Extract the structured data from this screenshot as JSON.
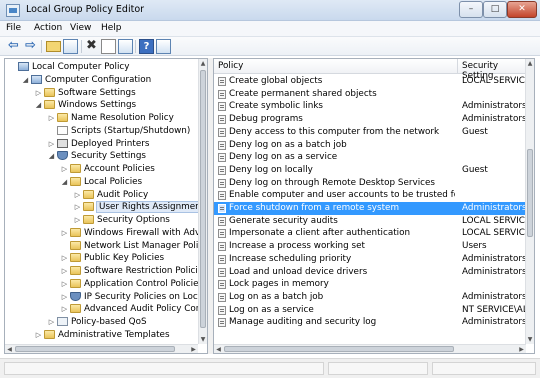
{
  "window": {
    "title": "Local Group Policy Editor",
    "minimize": "–",
    "maximize": "□",
    "close": "✕"
  },
  "menu": [
    "File",
    "Action",
    "View",
    "Help"
  ],
  "toolbar": {
    "back": "⇦",
    "forward": "⇨",
    "delete": "✖",
    "help": "?",
    "icons": [
      "back-arrow-icon",
      "forward-arrow-icon",
      "up-folder-icon",
      "show-hide-tree-icon",
      "delete-icon",
      "properties-icon",
      "export-list-icon",
      "help-icon",
      "show-hide-action-pane-icon"
    ]
  },
  "tree": {
    "scroll": {
      "up": "▲",
      "down": "▼",
      "left": "◀",
      "right": "▶"
    },
    "items": [
      {
        "label": "Local Computer Policy",
        "depth": 0,
        "expander": "",
        "icon": "computer"
      },
      {
        "label": "Computer Configuration",
        "depth": 1,
        "expander": "◢",
        "icon": "computer"
      },
      {
        "label": "Software Settings",
        "depth": 2,
        "expander": "▷",
        "icon": "folder"
      },
      {
        "label": "Windows Settings",
        "depth": 2,
        "expander": "◢",
        "icon": "folder"
      },
      {
        "label": "Name Resolution Policy",
        "depth": 3,
        "expander": "▷",
        "icon": "folder"
      },
      {
        "label": "Scripts (Startup/Shutdown)",
        "depth": 3,
        "expander": "",
        "icon": "doc"
      },
      {
        "label": "Deployed Printers",
        "depth": 3,
        "expander": "▷",
        "icon": "printer"
      },
      {
        "label": "Security Settings",
        "depth": 3,
        "expander": "◢",
        "icon": "shield"
      },
      {
        "label": "Account Policies",
        "depth": 4,
        "expander": "▷",
        "icon": "folder"
      },
      {
        "label": "Local Policies",
        "depth": 4,
        "expander": "◢",
        "icon": "folder"
      },
      {
        "label": "Audit Policy",
        "depth": 5,
        "expander": "▷",
        "icon": "folder"
      },
      {
        "label": "User Rights Assignment",
        "depth": 5,
        "expander": "▷",
        "icon": "folder",
        "selected": true
      },
      {
        "label": "Security Options",
        "depth": 5,
        "expander": "▷",
        "icon": "folder"
      },
      {
        "label": "Windows Firewall with Advance",
        "depth": 4,
        "expander": "▷",
        "icon": "folder"
      },
      {
        "label": "Network List Manager Policies",
        "depth": 4,
        "expander": "",
        "icon": "folder"
      },
      {
        "label": "Public Key Policies",
        "depth": 4,
        "expander": "▷",
        "icon": "folder"
      },
      {
        "label": "Software Restriction Policies",
        "depth": 4,
        "expander": "▷",
        "icon": "folder"
      },
      {
        "label": "Application Control Policies",
        "depth": 4,
        "expander": "▷",
        "icon": "folder"
      },
      {
        "label": "IP Security Policies on Local Co",
        "depth": 4,
        "expander": "▷",
        "icon": "shield"
      },
      {
        "label": "Advanced Audit Policy Configu",
        "depth": 4,
        "expander": "▷",
        "icon": "folder"
      },
      {
        "label": "Policy-based QoS",
        "depth": 3,
        "expander": "▷",
        "icon": "policy"
      },
      {
        "label": "Administrative Templates",
        "depth": 2,
        "expander": "▷",
        "icon": "folder"
      }
    ]
  },
  "list": {
    "columns": {
      "policy": "Policy",
      "setting": "Security Setting"
    },
    "scroll": {
      "up": "▲",
      "down": "▼",
      "left": "◀",
      "right": "▶"
    },
    "rows": [
      {
        "policy": "Create global objects",
        "setting": "LOCAL SERVICE,..."
      },
      {
        "policy": "Create permanent shared objects",
        "setting": ""
      },
      {
        "policy": "Create symbolic links",
        "setting": "Administrators"
      },
      {
        "policy": "Debug programs",
        "setting": "Administrators"
      },
      {
        "policy": "Deny access to this computer from the network",
        "setting": "Guest"
      },
      {
        "policy": "Deny log on as a batch job",
        "setting": ""
      },
      {
        "policy": "Deny log on as a service",
        "setting": ""
      },
      {
        "policy": "Deny log on locally",
        "setting": "Guest"
      },
      {
        "policy": "Deny log on through Remote Desktop Services",
        "setting": ""
      },
      {
        "policy": "Enable computer and user accounts to be trusted for delega...",
        "setting": ""
      },
      {
        "policy": "Force shutdown from a remote system",
        "setting": "Administrators",
        "selected": true
      },
      {
        "policy": "Generate security audits",
        "setting": "LOCAL SERVICE,..."
      },
      {
        "policy": "Impersonate a client after authentication",
        "setting": "LOCAL SERVICE,..."
      },
      {
        "policy": "Increase a process working set",
        "setting": "Users"
      },
      {
        "policy": "Increase scheduling priority",
        "setting": "Administrators"
      },
      {
        "policy": "Load and unload device drivers",
        "setting": "Administrators"
      },
      {
        "policy": "Lock pages in memory",
        "setting": ""
      },
      {
        "policy": "Log on as a batch job",
        "setting": "Administrators,B..."
      },
      {
        "policy": "Log on as a service",
        "setting": "NT SERVICE\\ALL..."
      },
      {
        "policy": "Manage auditing and security log",
        "setting": "Administrators"
      }
    ]
  }
}
